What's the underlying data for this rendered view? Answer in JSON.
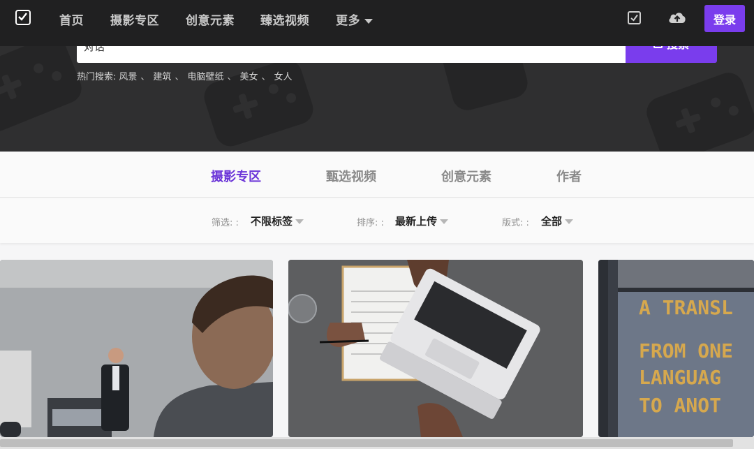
{
  "nav": {
    "items": [
      "首页",
      "摄影专区",
      "创意元素",
      "臻选视频"
    ],
    "more_label": "更多",
    "login_label": "登录",
    "icons": [
      "logo-check-icon",
      "check-icon",
      "cloud-upload-icon",
      "chevron-down-icon"
    ]
  },
  "search": {
    "value": "对话",
    "button_label": "搜索",
    "hot_label": "热门搜索:",
    "hot_tags": [
      "风景",
      "建筑",
      "电脑壁纸",
      "美女",
      "女人"
    ],
    "separator": "、"
  },
  "tabs": [
    {
      "label": "摄影专区",
      "active": true
    },
    {
      "label": "甄选视频",
      "active": false
    },
    {
      "label": "创意元素",
      "active": false
    },
    {
      "label": "作者",
      "active": false
    }
  ],
  "filters": [
    {
      "label": "筛选: :",
      "value": "不限标签"
    },
    {
      "label": "排序: :",
      "value": "最新上传"
    },
    {
      "label": "版式: :",
      "value": "全部"
    }
  ],
  "cards": [
    {
      "name": "presentation-photo"
    },
    {
      "name": "laptop-desk-photo"
    },
    {
      "name": "translation-plaque-photo",
      "text_lines": [
        "A TRANSL",
        "FROM ONE",
        "LANGUAG",
        "TO ANOT"
      ]
    }
  ],
  "colors": {
    "accent": "#7a3ded",
    "active_tab": "#6b35d8",
    "nav_bg": "#202021",
    "hero_bg": "#2f2f30"
  }
}
